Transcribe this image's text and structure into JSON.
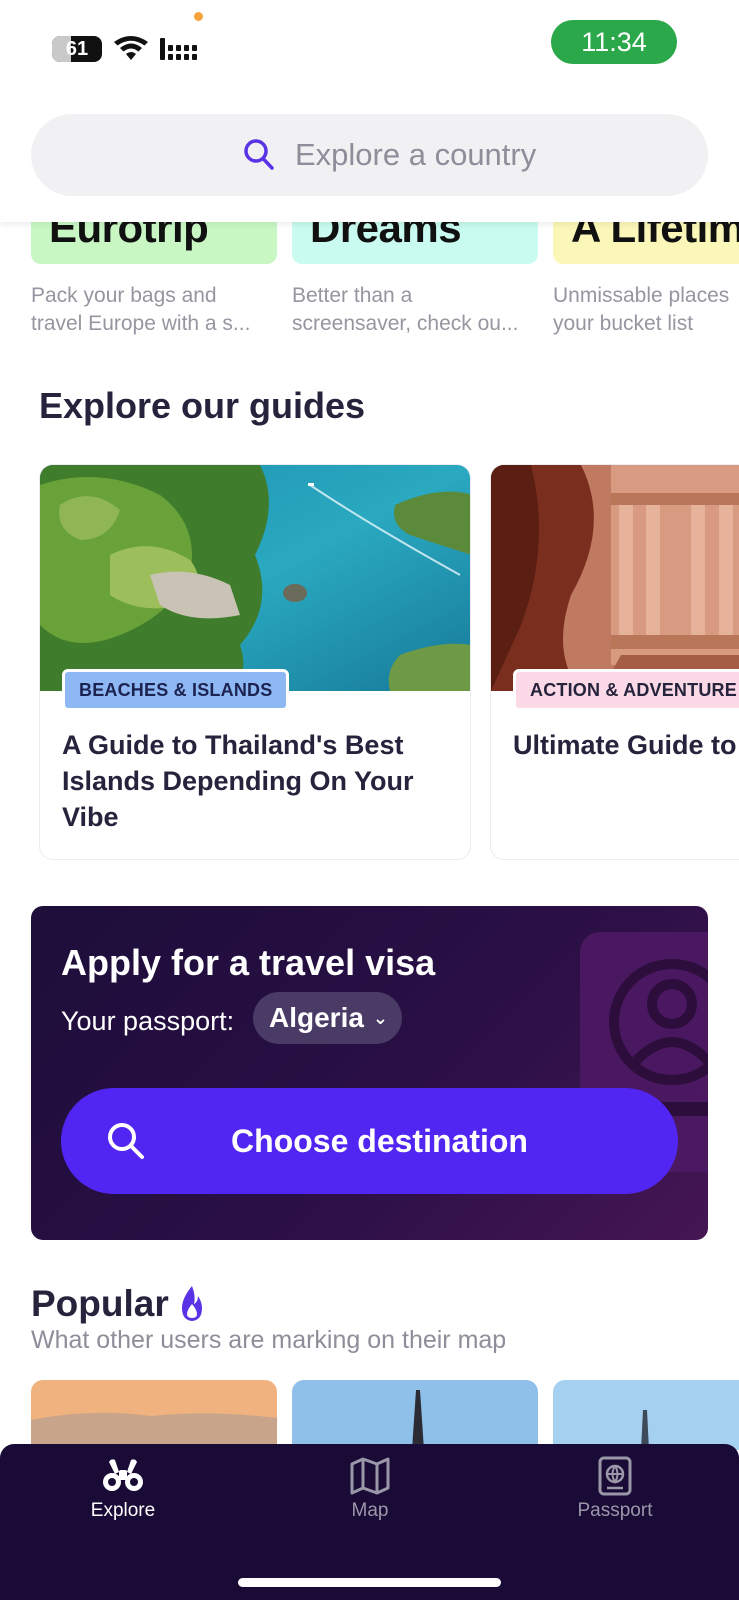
{
  "status_bar": {
    "battery": "61",
    "time": "11:34"
  },
  "search": {
    "placeholder": "Explore a country"
  },
  "collections": [
    {
      "title": "Eurotrip",
      "desc_line1": "Pack your bags and",
      "desc_line2": "travel Europe with a s...",
      "color": "#c8f7c4"
    },
    {
      "title": "Dreams",
      "desc_line1": "Better than a",
      "desc_line2": "screensaver, check ou...",
      "color": "#c9fbf0"
    },
    {
      "title": "A Lifetim",
      "desc_line1": "Unmissable places",
      "desc_line2": "your bucket list",
      "color": "#fbf7b8"
    }
  ],
  "guides": {
    "title": "Explore our guides",
    "items": [
      {
        "tag": "BEACHES & ISLANDS",
        "title": "A Guide to Thailand's Best Islands Depending On Your Vibe",
        "tag_bg": "#8db8f3",
        "tag_color": "#1d2350"
      },
      {
        "tag": "ACTION & ADVENTURE",
        "title": "Ultimate Guide to Petra, Dead Sea &",
        "tag_bg": "#fbd9e6",
        "tag_color": "#26233c"
      }
    ]
  },
  "visa": {
    "title": "Apply for a travel visa",
    "passport_label": "Your passport:",
    "passport_value": "Algeria",
    "cta": "Choose destination"
  },
  "popular": {
    "title": "Popular",
    "subtitle": "What other users are marking on their map"
  },
  "nav": {
    "explore": "Explore",
    "map": "Map",
    "passport": "Passport"
  },
  "colors": {
    "accent": "#5226f2",
    "nav_bg": "#1a0a36",
    "visa_bg": "#2a0f45"
  }
}
